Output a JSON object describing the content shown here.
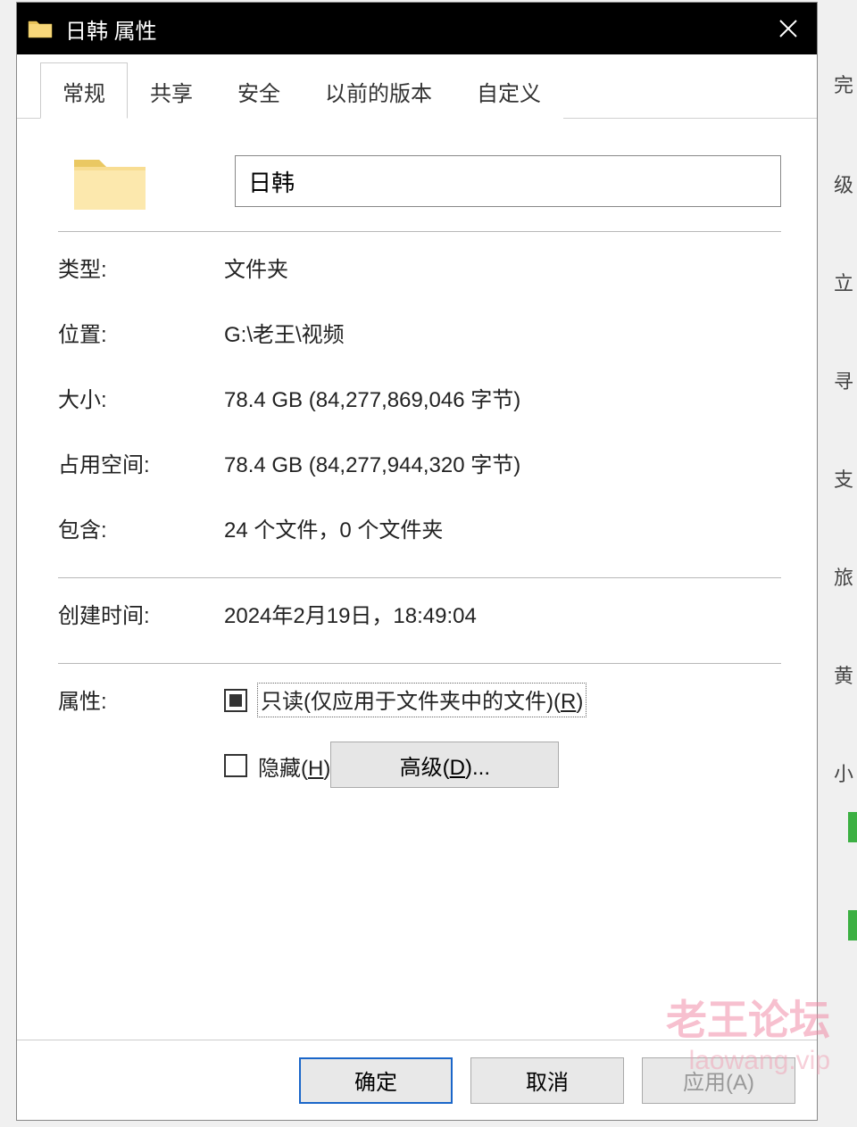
{
  "titlebar": {
    "title": "日韩 属性"
  },
  "tabs": {
    "general": "常规",
    "sharing": "共享",
    "security": "安全",
    "previous": "以前的版本",
    "custom": "自定义"
  },
  "folder": {
    "name": "日韩"
  },
  "labels": {
    "type": "类型:",
    "location": "位置:",
    "size": "大小:",
    "size_on_disk": "占用空间:",
    "contains": "包含:",
    "created": "创建时间:",
    "attributes": "属性:"
  },
  "values": {
    "type": "文件夹",
    "location": "G:\\老王\\视频",
    "size": "78.4 GB (84,277,869,046 字节)",
    "size_on_disk": "78.4 GB (84,277,944,320 字节)",
    "contains": "24 个文件，0 个文件夹",
    "created": "2024年2月19日，18:49:04"
  },
  "attributes": {
    "readonly_prefix": "只读(仅应用于文件夹中的文件)(",
    "readonly_key": "R",
    "readonly_suffix": ")",
    "hidden_prefix": "隐藏(",
    "hidden_key": "H",
    "hidden_suffix": ")",
    "advanced_prefix": "高级(",
    "advanced_key": "D",
    "advanced_suffix": ")..."
  },
  "buttons": {
    "ok": "确定",
    "cancel": "取消",
    "apply": "应用(A)"
  },
  "watermark": {
    "main": "老王论坛",
    "sub": "laowang.vip"
  },
  "background_fragments": [
    "完",
    "级",
    "立",
    "寻",
    "支",
    "旅",
    "黄",
    "小"
  ]
}
